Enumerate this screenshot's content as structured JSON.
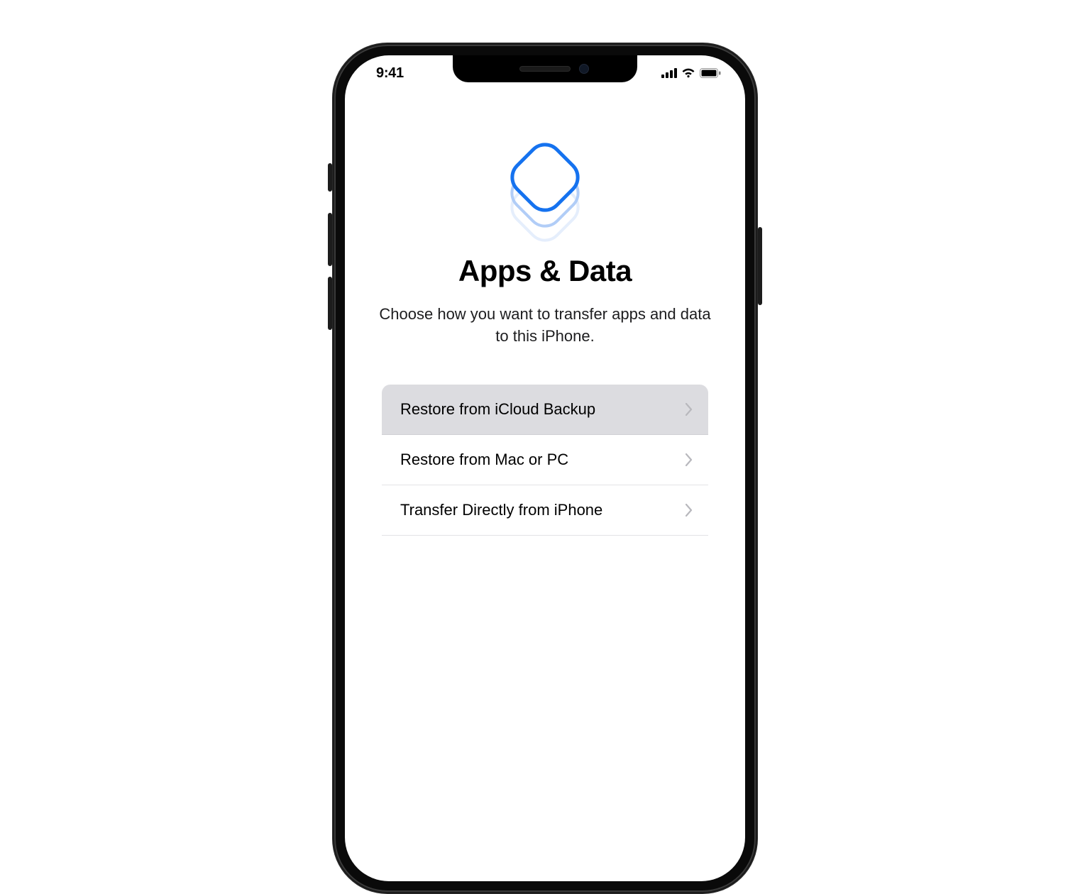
{
  "statusBar": {
    "time": "9:41"
  },
  "screen": {
    "hero_icon": "stacked-squircles",
    "title": "Apps & Data",
    "subtitle": "Choose how you want to transfer apps and data to this iPhone."
  },
  "options": [
    {
      "label": "Restore from iCloud Backup",
      "selected": true
    },
    {
      "label": "Restore from Mac or PC",
      "selected": false
    },
    {
      "label": "Transfer Directly from iPhone",
      "selected": false
    }
  ]
}
